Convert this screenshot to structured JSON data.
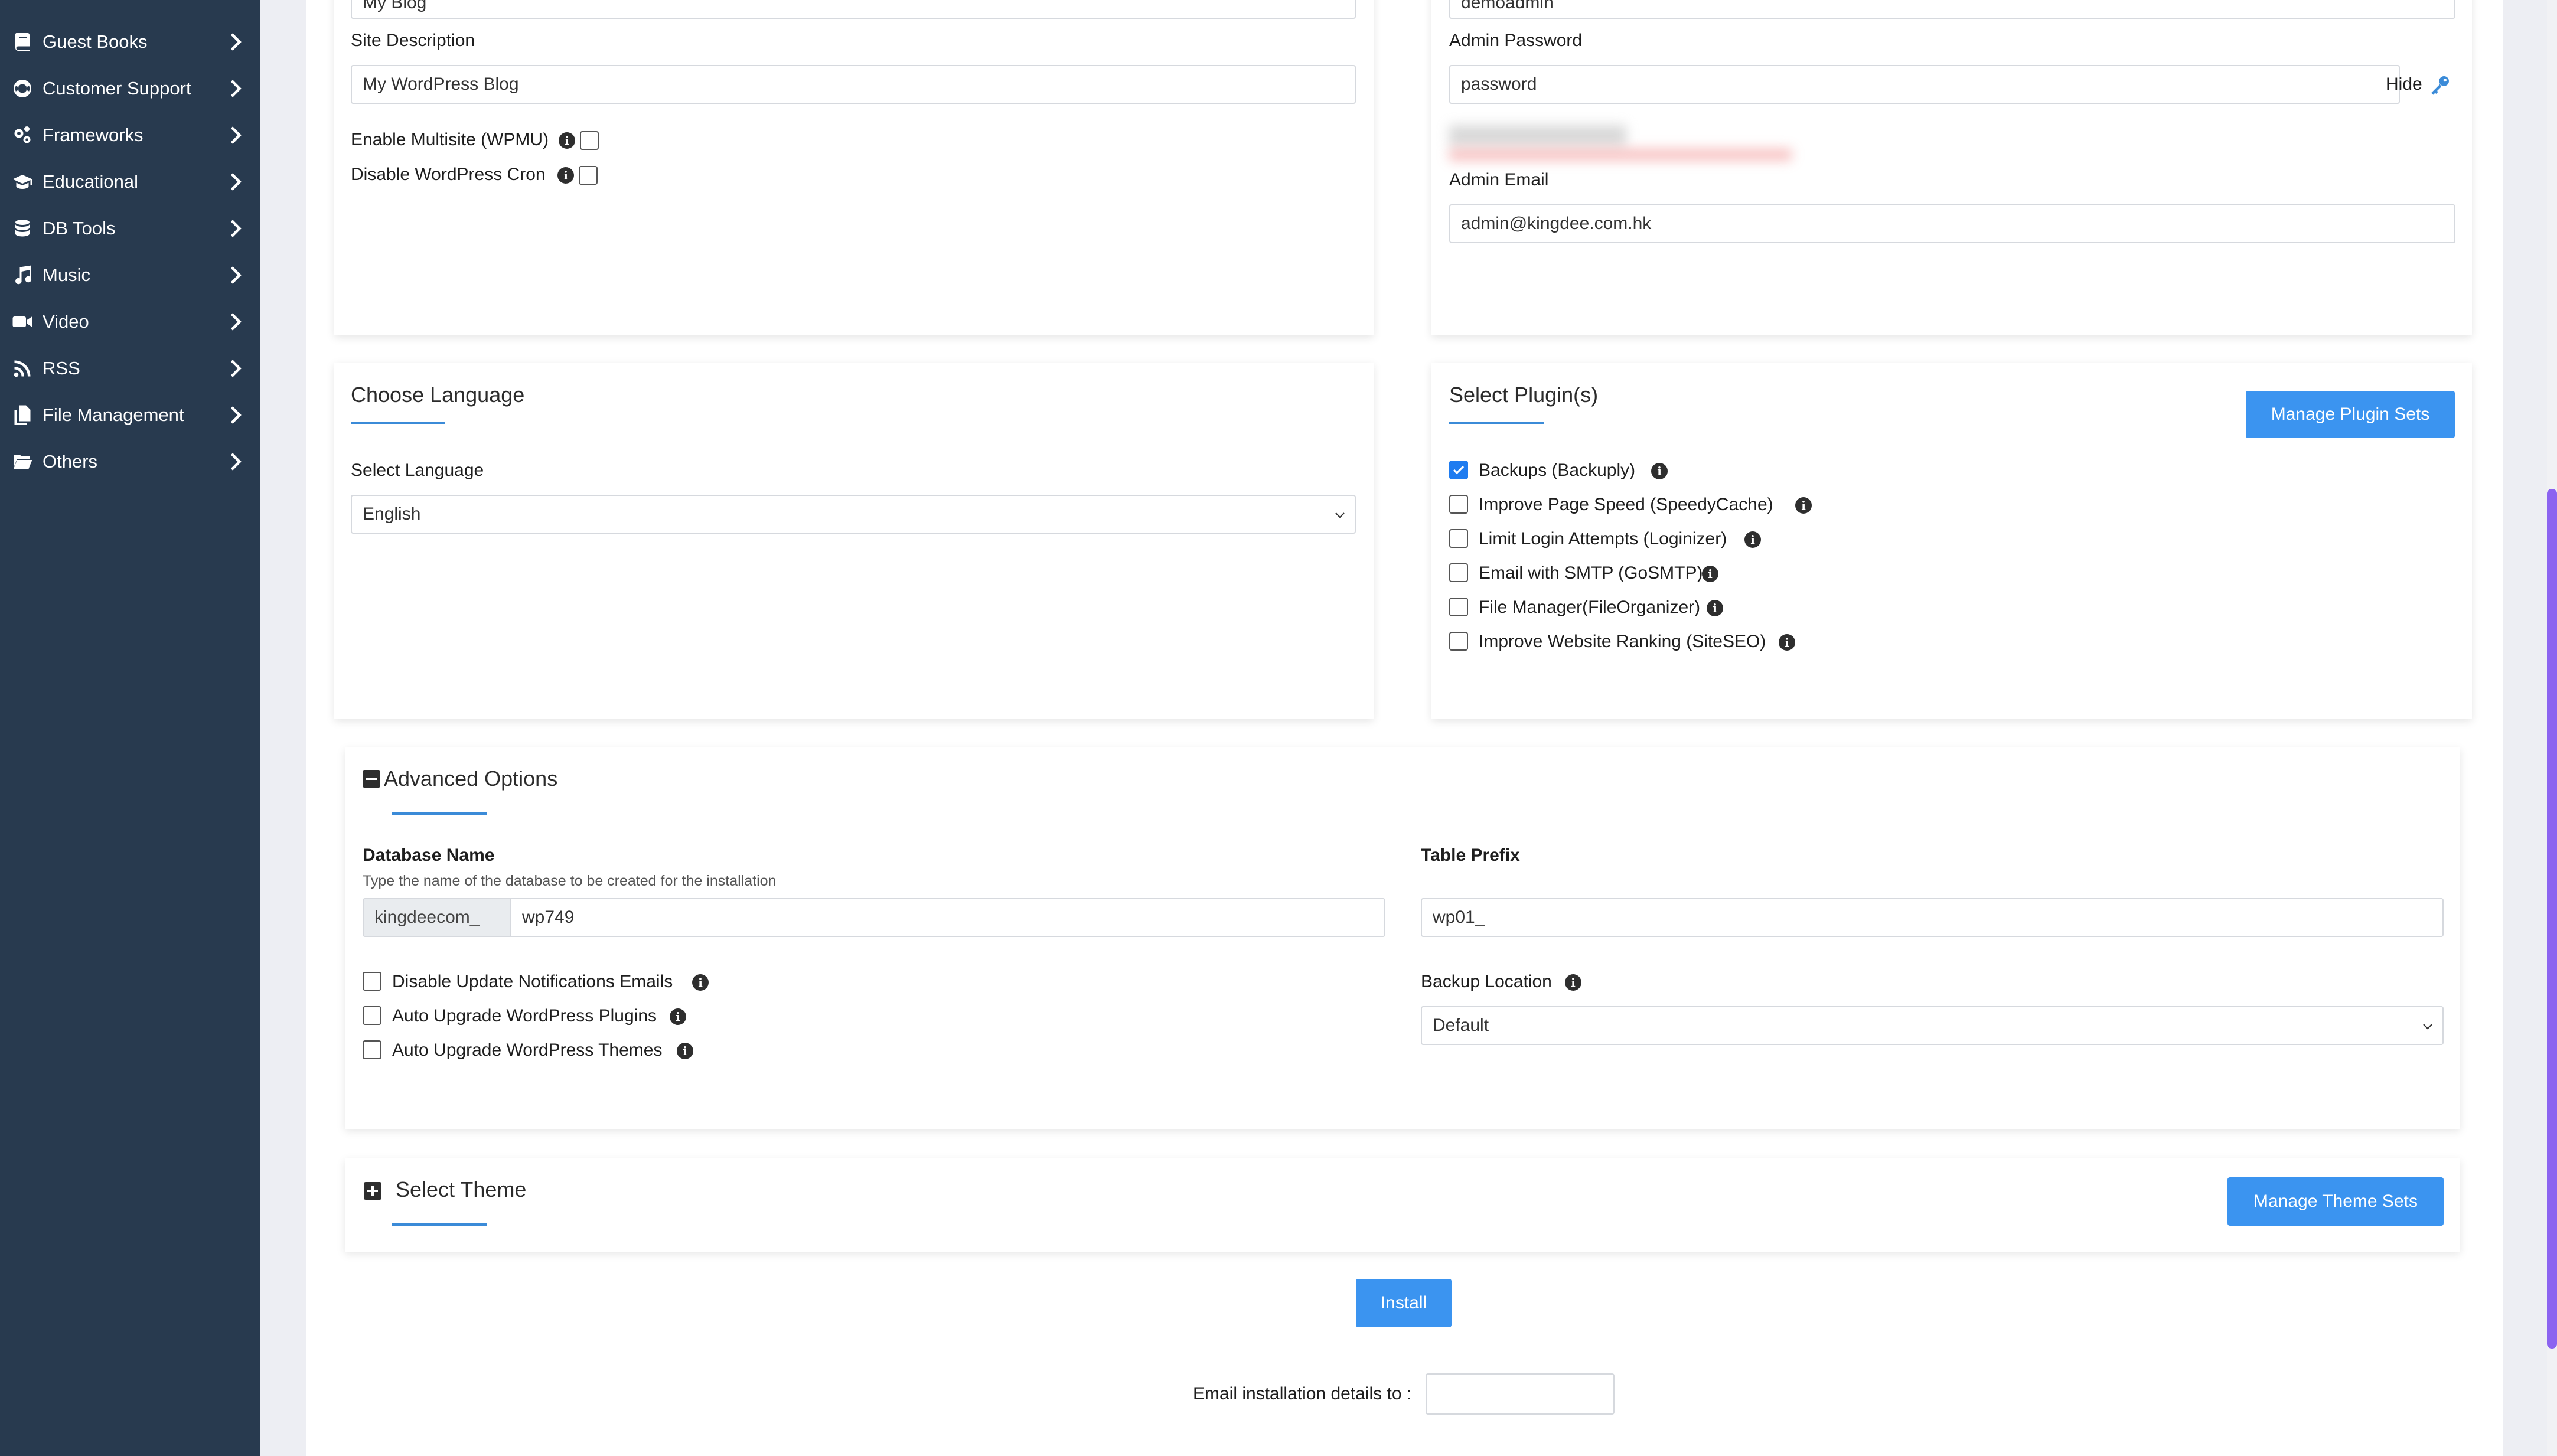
{
  "sidebar": {
    "items": [
      {
        "label": "Guest Books",
        "icon": "book-icon"
      },
      {
        "label": "Customer Support",
        "icon": "lifebuoy-icon"
      },
      {
        "label": "Frameworks",
        "icon": "gears-icon"
      },
      {
        "label": "Educational",
        "icon": "graduation-cap-icon"
      },
      {
        "label": "DB Tools",
        "icon": "database-icon"
      },
      {
        "label": "Music",
        "icon": "music-icon"
      },
      {
        "label": "Video",
        "icon": "video-icon"
      },
      {
        "label": "RSS",
        "icon": "rss-icon"
      },
      {
        "label": "File Management",
        "icon": "files-icon"
      },
      {
        "label": "Others",
        "icon": "folder-open-icon"
      }
    ]
  },
  "site_settings": {
    "site_name_value": "My Blog",
    "site_description_label": "Site Description",
    "site_description_value": "My WordPress Blog",
    "multisite_label": "Enable Multisite (WPMU)",
    "disable_cron_label": "Disable WordPress Cron"
  },
  "admin_account": {
    "username_value": "demoadmin",
    "password_label": "Admin Password",
    "password_value": "password",
    "hide_label": "Hide",
    "email_label": "Admin Email",
    "email_value": "admin@kingdee.com.hk"
  },
  "language": {
    "title": "Choose Language",
    "select_label": "Select Language",
    "selected": "English"
  },
  "plugins": {
    "title": "Select Plugin(s)",
    "manage_button": "Manage Plugin Sets",
    "items": [
      {
        "label": "Backups (Backuply)",
        "checked": true
      },
      {
        "label": "Improve Page Speed (SpeedyCache)",
        "checked": false
      },
      {
        "label": "Limit Login Attempts (Loginizer)",
        "checked": false
      },
      {
        "label": "Email with SMTP (GoSMTP)",
        "checked": false
      },
      {
        "label": "File Manager(FileOrganizer)",
        "checked": false
      },
      {
        "label": "Improve Website Ranking (SiteSEO)",
        "checked": false
      }
    ]
  },
  "advanced": {
    "title": "Advanced Options",
    "db_name_label": "Database Name",
    "db_name_hint": "Type the name of the database to be created for the installation",
    "db_prefix_addon": "kingdeecom_",
    "db_name_value": "wp749",
    "table_prefix_label": "Table Prefix",
    "table_prefix_value": "wp01_",
    "options": [
      {
        "label": "Disable Update Notifications Emails",
        "checked": false
      },
      {
        "label": "Auto Upgrade WordPress Plugins",
        "checked": false
      },
      {
        "label": "Auto Upgrade WordPress Themes",
        "checked": false
      }
    ],
    "backup_location_label": "Backup Location",
    "backup_location_value": "Default"
  },
  "theme": {
    "title": "Select Theme",
    "manage_button": "Manage Theme Sets"
  },
  "install": {
    "button": "Install",
    "email_label": "Email installation details to :",
    "email_value": ""
  },
  "colors": {
    "sidebar_bg": "#283a4f",
    "accent": "#3b94f0",
    "underline": "#3b8bd8",
    "scrollbar": "#8c63f0"
  }
}
